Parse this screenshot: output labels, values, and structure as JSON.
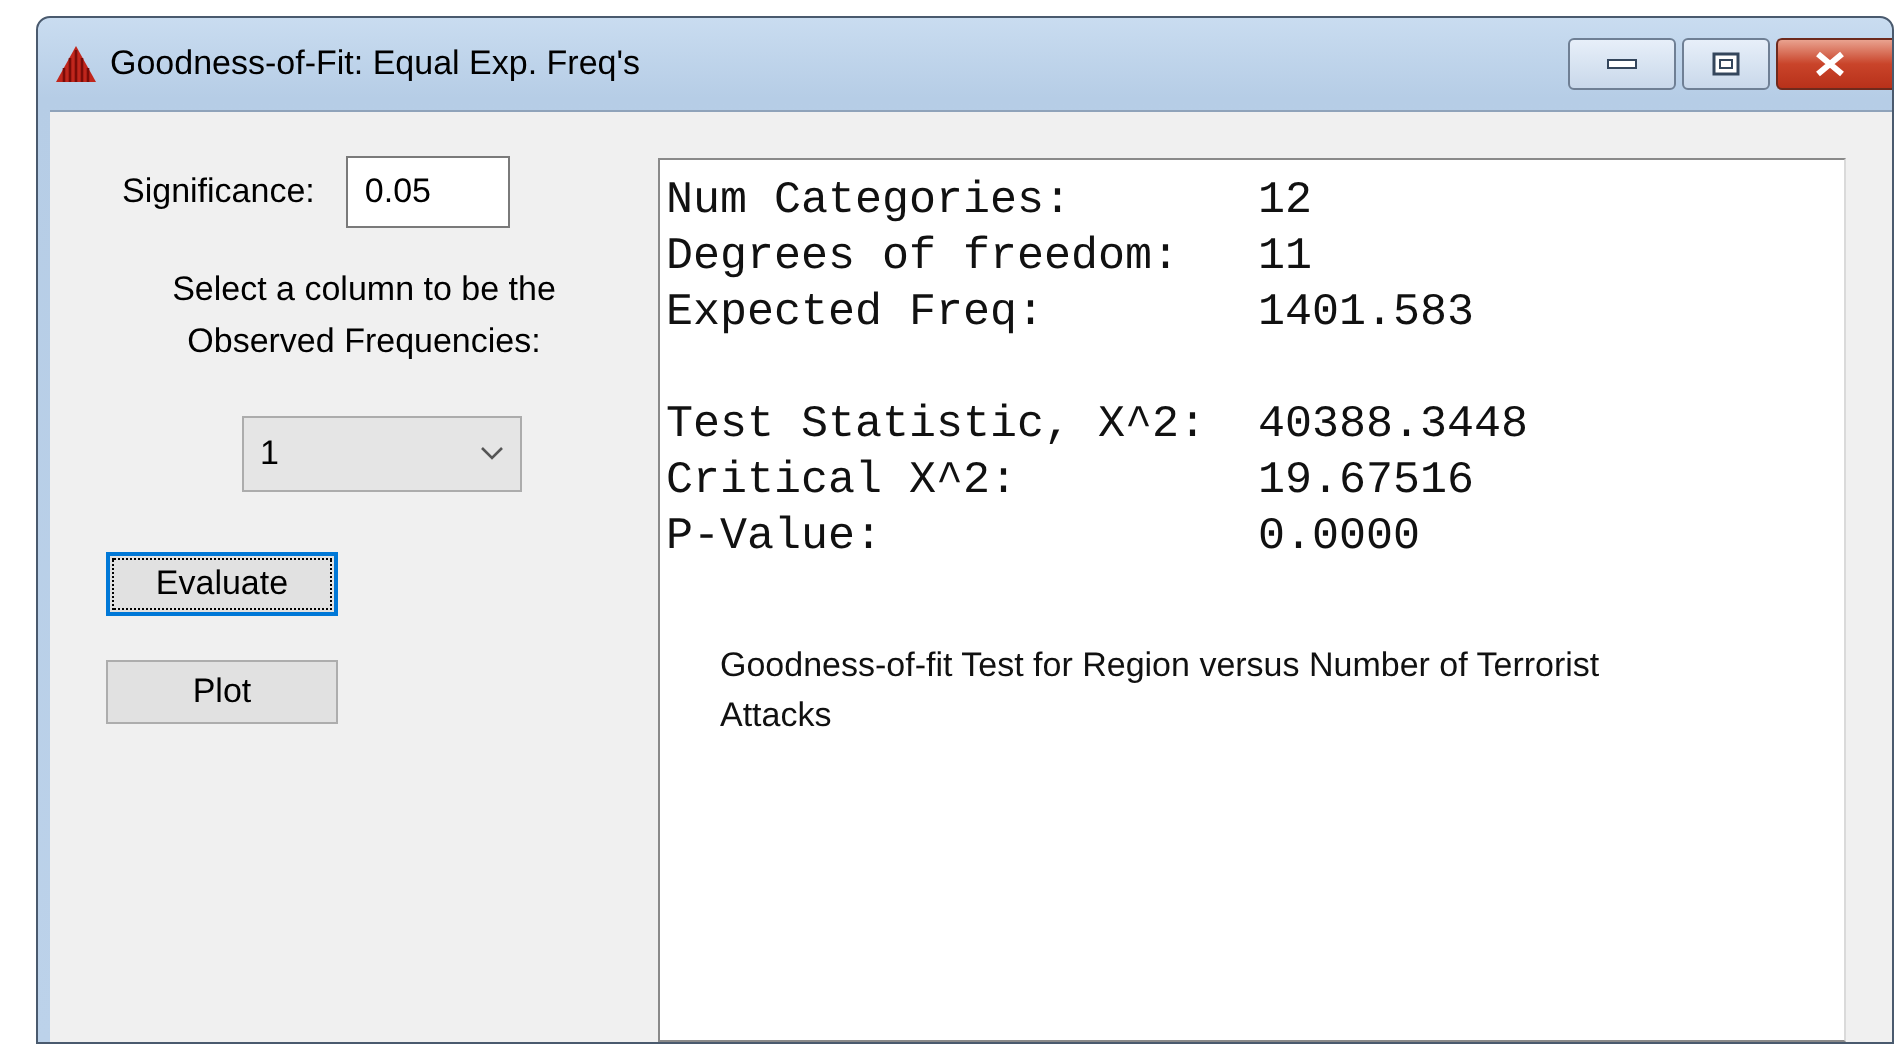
{
  "window": {
    "title": "Goodness-of-Fit:  Equal Exp. Freq's"
  },
  "significance": {
    "label": "Significance:",
    "value": "0.05"
  },
  "column_prompt": "Select a column to be the Observed Frequencies:",
  "column_select": {
    "value": "1"
  },
  "buttons": [
    {
      "label": "Evaluate",
      "focused": true
    },
    {
      "label": "Plot",
      "focused": false
    }
  ],
  "output": {
    "groups": [
      [
        {
          "label": "Num Categories:",
          "value": "12"
        },
        {
          "label": "Degrees of freedom:",
          "value": "11"
        },
        {
          "label": "Expected Freq:",
          "value": "1401.583"
        }
      ],
      [
        {
          "label": "Test Statistic, X^2:",
          "value": "40388.3448"
        },
        {
          "label": "Critical X^2:",
          "value": "19.67516"
        },
        {
          "label": "P-Value:",
          "value": "0.0000"
        }
      ]
    ],
    "note": "Goodness-of-fit Test for Region versus Number of Terrorist Attacks"
  }
}
